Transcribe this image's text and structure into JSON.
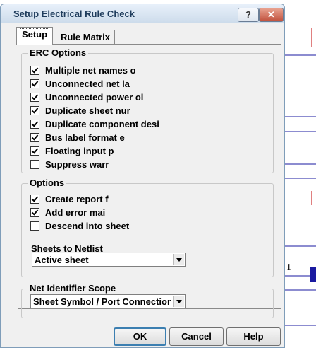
{
  "window": {
    "title": "Setup Electrical Rule Check",
    "help_glyph": "?",
    "close_glyph": "✕"
  },
  "tabs": [
    {
      "label": "Setup"
    },
    {
      "label": "Rule Matrix"
    }
  ],
  "erc_options": {
    "label": "ERC Options",
    "items": [
      {
        "label": "Multiple net names o",
        "checked": true
      },
      {
        "label": "Unconnected net la",
        "checked": true
      },
      {
        "label": "Unconnected power ol",
        "checked": true
      },
      {
        "label": "Duplicate sheet nur",
        "checked": true
      },
      {
        "label": "Duplicate component desi",
        "checked": true
      },
      {
        "label": "Bus label format e",
        "checked": true
      },
      {
        "label": "Floating input p",
        "checked": true
      },
      {
        "label": "Suppress warr",
        "checked": false
      }
    ]
  },
  "options": {
    "label": "Options",
    "items": [
      {
        "label": "Create report f",
        "checked": true
      },
      {
        "label": "Add error mai",
        "checked": true
      },
      {
        "label": "Descend into sheet",
        "checked": false
      }
    ],
    "sheets_label": "Sheets to Netlist",
    "sheets_value": "Active sheet"
  },
  "net_scope": {
    "label": "Net Identifier Scope",
    "value": "Sheet Symbol / Port Connections"
  },
  "buttons": {
    "ok": "OK",
    "cancel": "Cancel",
    "help": "Help"
  },
  "background": {
    "pin_label": "1"
  }
}
